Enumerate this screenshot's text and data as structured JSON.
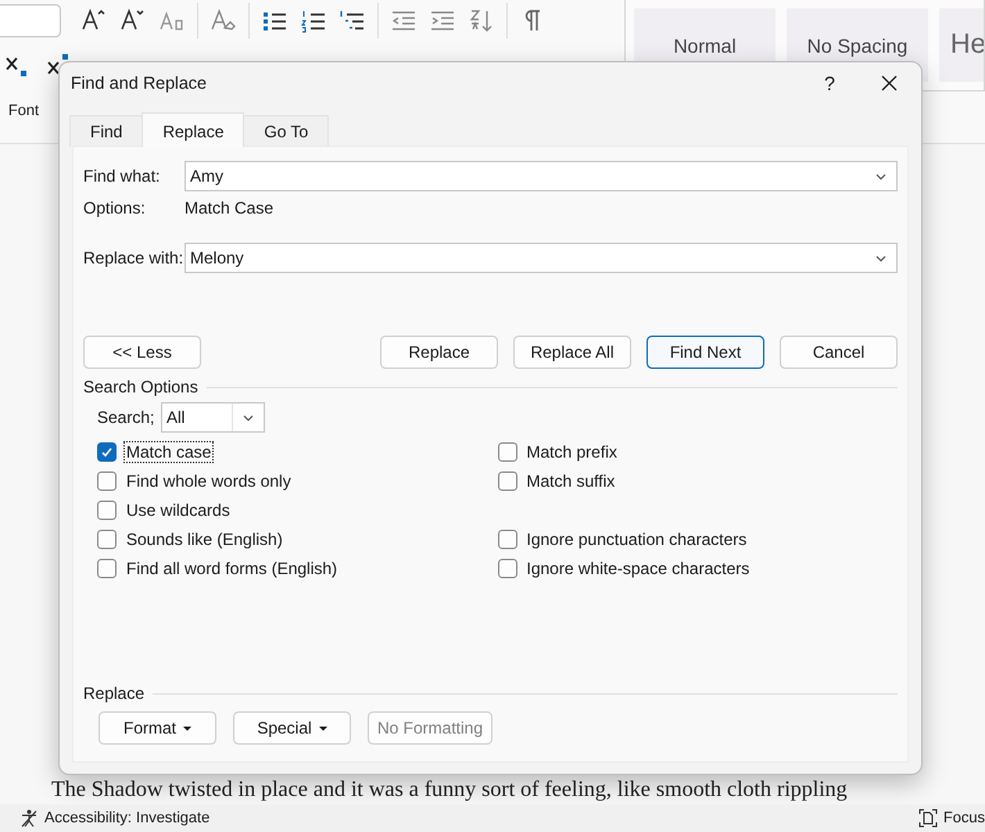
{
  "ribbon": {
    "styles": [
      {
        "name": "Normal"
      },
      {
        "name": "No Spacing"
      },
      {
        "name": "He"
      }
    ],
    "group_label": "Font"
  },
  "document": {
    "visible_line": "The Shadow twisted in place and it was a funny sort of feeling, like smooth cloth rippling"
  },
  "status_bar": {
    "accessibility": "Accessibility: Investigate",
    "focus": "Focus"
  },
  "dialog": {
    "title": "Find and Replace",
    "help": "?",
    "tabs": [
      {
        "label": "Find",
        "selected": false
      },
      {
        "label": "Replace",
        "selected": true
      },
      {
        "label": "Go To",
        "selected": false
      }
    ],
    "find_what": {
      "label": "Find what:",
      "value": "Amy"
    },
    "options": {
      "label": "Options:",
      "value": "Match Case"
    },
    "replace_with": {
      "label": "Replace with:",
      "value": "Melony"
    },
    "buttons": [
      {
        "label": "<< Less",
        "default": false
      },
      {
        "label": "Replace",
        "default": false
      },
      {
        "label": "Replace All",
        "default": false
      },
      {
        "label": "Find Next",
        "default": true
      },
      {
        "label": "Cancel",
        "default": false
      }
    ],
    "search_options": {
      "title": "Search Options",
      "search_label": "Search;",
      "search_value": "All",
      "left": [
        {
          "label": "Match case",
          "checked": true,
          "focused": true
        },
        {
          "label": "Find whole words only",
          "checked": false,
          "focused": false
        },
        {
          "label": "Use wildcards",
          "checked": false,
          "focused": false
        },
        {
          "label": "Sounds like (English)",
          "checked": false,
          "focused": false
        },
        {
          "label": "Find all word forms (English)",
          "checked": false,
          "focused": false
        }
      ],
      "right_groups": [
        [
          {
            "label": "Match prefix",
            "checked": false,
            "focused": false
          },
          {
            "label": "Match suffix",
            "checked": false,
            "focused": false
          }
        ],
        [
          {
            "label": "Ignore punctuation characters",
            "checked": false,
            "focused": false
          },
          {
            "label": "Ignore white-space characters",
            "checked": false,
            "focused": false
          }
        ]
      ]
    },
    "replace_section": {
      "title": "Replace",
      "buttons": [
        {
          "label": "Format",
          "menu": true,
          "disabled": false
        },
        {
          "label": "Special",
          "menu": true,
          "disabled": false
        },
        {
          "label": "No Formatting",
          "menu": false,
          "disabled": true
        }
      ]
    }
  }
}
